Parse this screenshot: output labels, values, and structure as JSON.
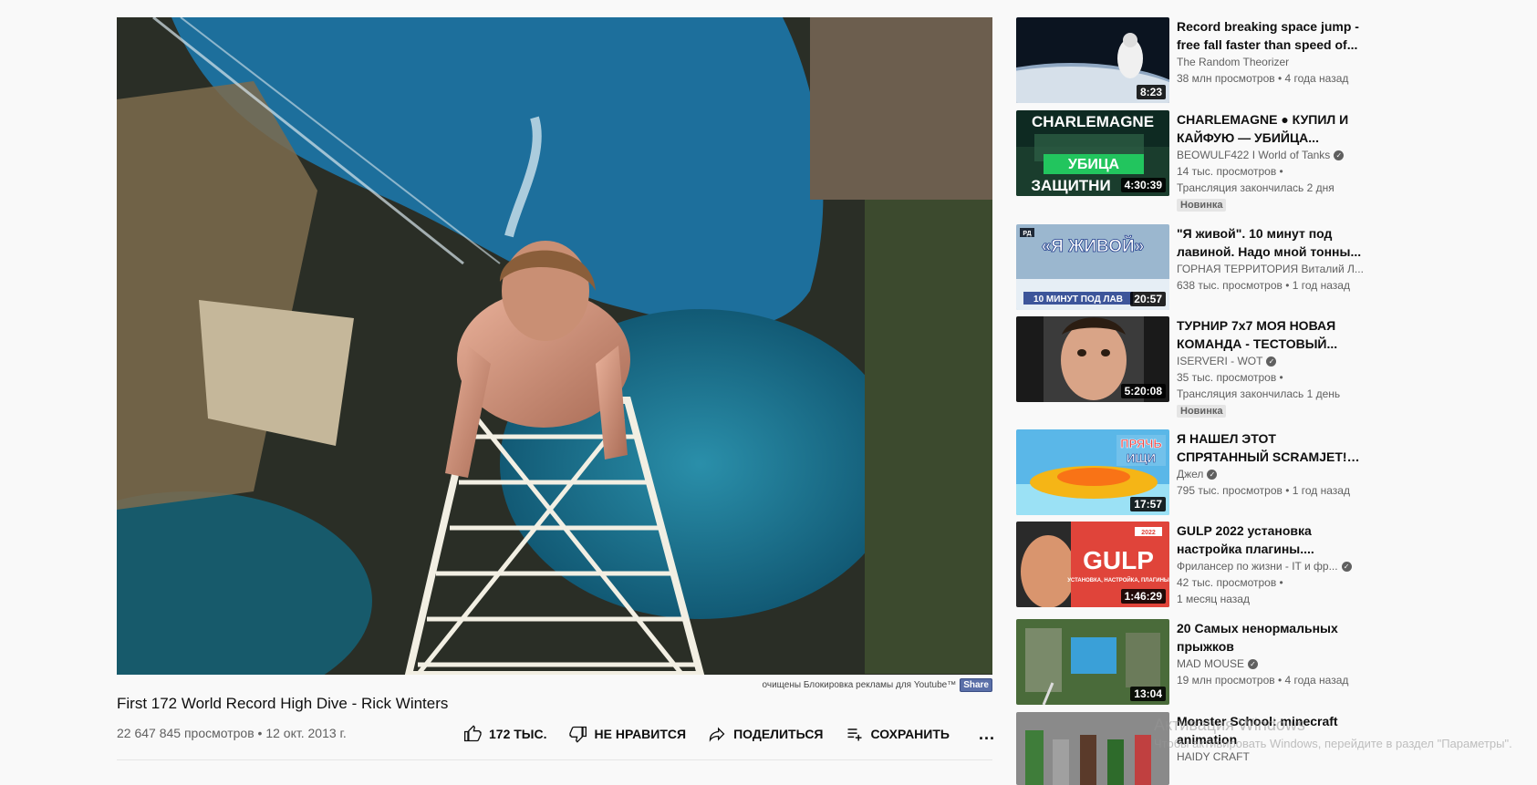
{
  "video": {
    "title": "First 172 World Record High Dive - Rick Winters",
    "views": "22 647 845 просмотров",
    "date": "12 окт. 2013 г.",
    "likes": "172 ТЫС.",
    "dislike_label": "НЕ НРАВИТСЯ",
    "share_label": "ПОДЕЛИТЬСЯ",
    "save_label": "СОХРАНИТЬ",
    "more_label": "..."
  },
  "adblock": {
    "text": "очищены Блокировка рекламы для Youtube™",
    "share": "Share"
  },
  "recommendations": [
    {
      "title": "Record breaking space jump - free fall faster than speed of...",
      "channel": "The Random Theorizer",
      "verified": false,
      "views": "38 млн просмотров",
      "age": "4 года назад",
      "duration": "8:23",
      "badge": ""
    },
    {
      "title": "CHARLEMAGNE ● КУПИЛ И КАЙФУЮ — УБИЙЦА...",
      "channel": "BEOWULF422 I World of Tanks",
      "verified": true,
      "views": "14 тыс. просмотров",
      "age": "Трансляция закончилась 2 дня",
      "duration": "4:30:39",
      "badge": "Новинка"
    },
    {
      "title": "\"Я живой\". 10 минут под лавиной. Надо мной тонны...",
      "channel": "ГОРНАЯ ТЕРРИТОРИЯ Виталий Л...",
      "verified": false,
      "views": "638 тыс. просмотров",
      "age": "1 год назад",
      "duration": "20:57",
      "badge": ""
    },
    {
      "title": "ТУРНИР 7х7 МОЯ НОВАЯ КОМАНДА - ТЕСТОВЫЙ...",
      "channel": "ISERVERI - WOT",
      "verified": true,
      "views": "35 тыс. просмотров",
      "age": "Трансляция закончилась 1 день",
      "duration": "5:20:08",
      "badge": "Новинка"
    },
    {
      "title": "Я НАШЕЛ ЭТОТ СПРЯТАННЫЙ SCRAMJET! ПРЯЧЬ & ИЩИ В...",
      "channel": "Джел",
      "verified": true,
      "views": "795 тыс. просмотров",
      "age": "1 год назад",
      "duration": "17:57",
      "badge": ""
    },
    {
      "title": "GULP 2022 установка настройка плагины....",
      "channel": "Фрилансер по жизни - IT и фр...",
      "verified": true,
      "views": "42 тыс. просмотров",
      "age": "1 месяц назад",
      "duration": "1:46:29",
      "badge": ""
    },
    {
      "title": "20 Самых ненормальных прыжков",
      "channel": "MAD MOUSE",
      "verified": true,
      "views": "19 млн просмотров",
      "age": "4 года назад",
      "duration": "13:04",
      "badge": ""
    },
    {
      "title": "Monster School: minecraft animation",
      "channel": "HAIDY CRAFT",
      "verified": false,
      "views": "",
      "age": "",
      "duration": "",
      "badge": ""
    }
  ],
  "thumb_texts": {
    "t2_top": "CHARLEMAGNE",
    "t2_bottom1": "УБИЦА",
    "t2_bottom2": "ЗАЩИТНИ",
    "t3_main": "«Я ЖИВОЙ»",
    "t3_sub": "10 МИНУТ ПОД ЛАВ",
    "t3_tag": "РД",
    "t5_main": "ПРЯЧЬ",
    "t5_sub": "ИЩИ",
    "t6_main": "GULP",
    "t6_sub": "УСТАНОВКА, НАСТРОЙКА, ПЛАГИНЫ",
    "t6_year": "2022"
  },
  "watermark": {
    "line1": "Активация Windows",
    "line2": "Чтобы активировать Windows, перейдите в раздел \"Параметры\"."
  }
}
